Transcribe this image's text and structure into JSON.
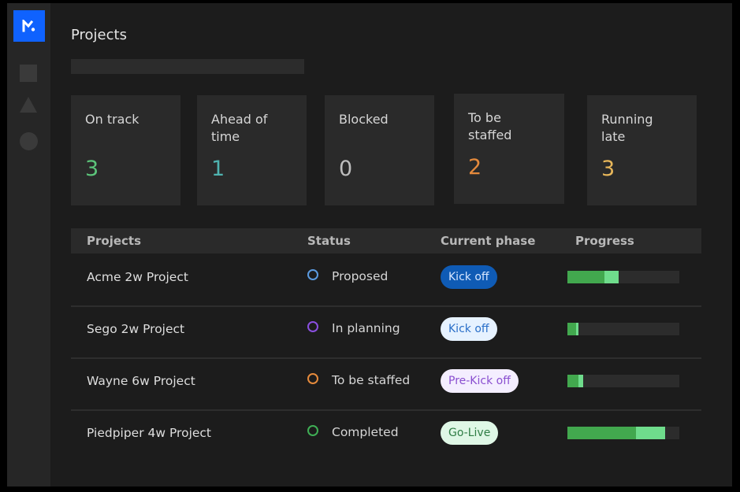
{
  "app": {
    "logo_icon": "brand-logo-icon",
    "sidebar_icons": [
      "square-icon",
      "triangle-icon",
      "circle-icon"
    ]
  },
  "header": {
    "title": "Projects"
  },
  "summary_cards": [
    {
      "label": "On track",
      "value": "3",
      "color": "#5cc47a"
    },
    {
      "label": "Ahead of time",
      "value": "1",
      "color": "#4fb3b0"
    },
    {
      "label": "Blocked",
      "value": "0",
      "color": "#bdbdbd"
    },
    {
      "label": "To be staffed",
      "value": "2",
      "color": "#e58a3c"
    },
    {
      "label": "Running late",
      "value": "3",
      "color": "#e8b75a"
    }
  ],
  "table": {
    "headers": [
      "Projects",
      "Status",
      "Current phase",
      "Progress"
    ],
    "rows": [
      {
        "project": "Acme 2w Project",
        "status": "Proposed",
        "status_color": "#5b9be0",
        "phase": "Kick off",
        "phase_bg": "#0f5bb5",
        "phase_fg": "#d6e6ff",
        "progress_total": 0.46,
        "progress_done": 0.33
      },
      {
        "project": "Sego 2w Project",
        "status": "In planning",
        "status_color": "#8a4fe0",
        "phase": "Kick off",
        "phase_bg": "#e6f2ff",
        "phase_fg": "#2a6fc9",
        "progress_total": 0.1,
        "progress_done": 0.08
      },
      {
        "project": "Wayne 6w Project",
        "status": "To be staffed",
        "status_color": "#e58a3c",
        "phase": "Pre-Kick off",
        "phase_bg": "#f4eeff",
        "phase_fg": "#8a4fd0",
        "progress_total": 0.14,
        "progress_done": 0.1
      },
      {
        "project": "Piedpiper 4w Project",
        "status": "Completed",
        "status_color": "#3fae55",
        "phase": "Go-Live",
        "phase_bg": "#dff7e6",
        "phase_fg": "#2f7d45",
        "progress_total": 0.87,
        "progress_done": 0.61
      }
    ]
  }
}
